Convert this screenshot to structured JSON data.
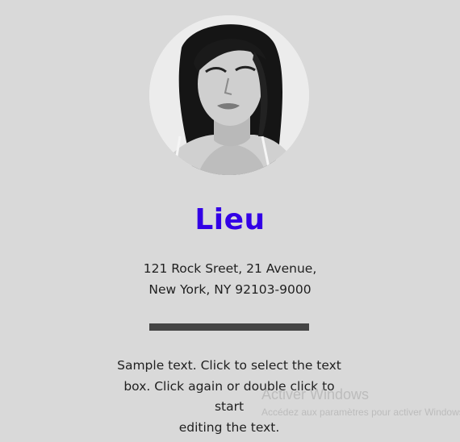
{
  "profile": {
    "photo_alt": "portrait photo",
    "name": "Lieu",
    "name_color": "#3300e6",
    "address_line1": "121 Rock Sreet, 21 Avenue,",
    "address_line2": "New York, NY 92103-9000"
  },
  "body_text": {
    "line1": "Sample text. Click to select the text",
    "line2": "box. Click again or double click to start",
    "line3": "editing the text."
  },
  "watermark": {
    "title": "Activer Windows",
    "subtitle": "Accédez aux paramètres pour activer Windows."
  },
  "colors": {
    "background": "#d9d9d9",
    "divider": "#444444",
    "text": "#1f1f1f"
  }
}
